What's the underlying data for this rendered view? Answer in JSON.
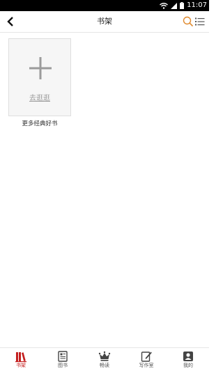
{
  "status_bar": {
    "time": "11:07"
  },
  "header": {
    "title": "书架"
  },
  "bookshelf": {
    "add_label": "去逛逛",
    "more_label": "更多经典好书"
  },
  "bottom_nav": {
    "items": [
      {
        "label": "书架",
        "icon": "bookshelf-icon",
        "active": true
      },
      {
        "label": "图书",
        "icon": "book-icon",
        "active": false
      },
      {
        "label": "畅读",
        "icon": "crown-icon",
        "active": false
      },
      {
        "label": "写作室",
        "icon": "write-icon",
        "active": false
      },
      {
        "label": "我的",
        "icon": "profile-icon",
        "active": false
      }
    ]
  },
  "colors": {
    "accent": "#c41f1f",
    "search": "#e08a2e"
  }
}
